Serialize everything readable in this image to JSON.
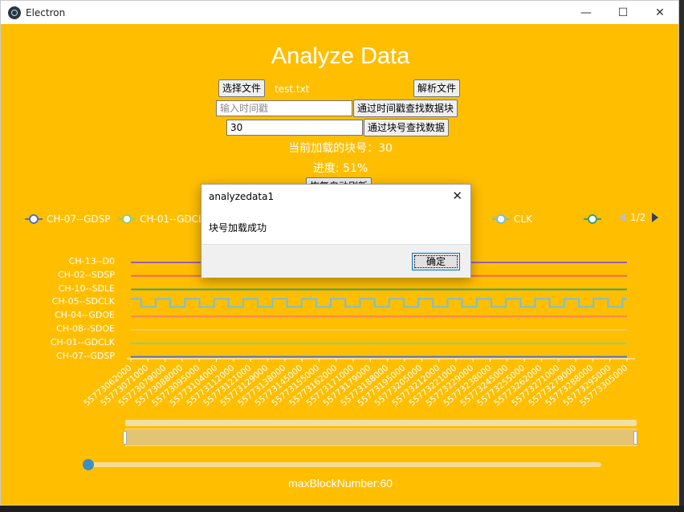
{
  "window": {
    "title": "Electron",
    "controls": {
      "minimize": "—",
      "maximize": "☐",
      "close": "✕"
    }
  },
  "page": {
    "heading": "Analyze Data",
    "choose_file_label": "选择文件",
    "file_name": "test.txt",
    "parse_file_label": "解析文件",
    "timestamp_placeholder": "输入时间戳",
    "find_by_timestamp_label": "通过时间戳查找数据块",
    "block_number_value": "30",
    "find_by_block_label": "通过块号查找数据",
    "current_block_text": "当前加载的块号：30",
    "progress_text": "进度: 51%",
    "auto_refresh_label": "恢复自动刷新",
    "max_block_text": "maxBlockNumber:60"
  },
  "colors": {
    "background": "#ffbe00",
    "accent": "#3b8fc4"
  },
  "chart_data": {
    "type": "line",
    "legend": {
      "items": [
        {
          "name": "CH-07--GDSP",
          "color": "#5470c6"
        },
        {
          "name": "CH-01--GDCLK",
          "color": "#91cc75"
        },
        {
          "name": "CH-05--SDCLK",
          "color": "#73c0de"
        },
        {
          "name": "CH-10--SDLE",
          "color": "#3ba272"
        },
        {
          "name": "CH-13--D0",
          "color": "#fc8452"
        }
      ],
      "page": "1/2"
    },
    "channels": [
      "CH-13--D0",
      "CH-02--SDSP",
      "CH-10--SDLE",
      "CH-05--SDCLK",
      "CH-04--GDOE",
      "CH-08--SDOE",
      "CH-01--GDCLK",
      "CH-07--GDSP"
    ],
    "x": [
      55773062000,
      55773071000,
      55773079000,
      55773088000,
      55773095000,
      55773104000,
      55773112000,
      55773121000,
      55773129000,
      55773138000,
      55773145000,
      55773155000,
      55773162000,
      55773171000,
      55773179000,
      55773188000,
      55773195000,
      55773205000,
      55773212000,
      55773221000,
      55773229000,
      55773238000,
      55773245000,
      55773255000,
      55773262000,
      55773271000,
      55773279000,
      55773288000,
      55773295000,
      55773305000
    ],
    "xlabels": [
      "55773062000",
      "55773071000",
      "55773079000",
      "55773088000",
      "55773095000",
      "55773104000",
      "55773112000",
      "55773121000",
      "55773129000",
      "55773138000",
      "55773145000",
      "55773155000",
      "55773162000",
      "55773171000",
      "55773179000",
      "55773188000",
      "55773195000",
      "55773205000",
      "55773212000",
      "55773221000",
      "55773229000",
      "55773238000",
      "55773245000",
      "55773255000",
      "55773262000",
      "55773271000",
      "55773279000",
      "55773288000",
      "55773295000",
      "55773305000"
    ],
    "series": [
      {
        "name": "CH-13--D0",
        "color": "#9a60b4",
        "pattern": "flat"
      },
      {
        "name": "CH-02--SDSP",
        "color": "#ee6666",
        "pattern": "flat"
      },
      {
        "name": "CH-10--SDLE",
        "color": "#3ba272",
        "pattern": "flat"
      },
      {
        "name": "CH-05--SDCLK",
        "color": "#73c0de",
        "pattern": "square",
        "periods": 17
      },
      {
        "name": "CH-04--GDOE",
        "color": "#fc8452",
        "pattern": "flat"
      },
      {
        "name": "CH-08--SDOE",
        "color": "#fac858",
        "pattern": "flat"
      },
      {
        "name": "CH-01--GDCLK",
        "color": "#91cc75",
        "pattern": "flat"
      },
      {
        "name": "CH-07--GDSP",
        "color": "#5470c6",
        "pattern": "flat"
      }
    ],
    "zoom": {
      "start": 0,
      "end": 100
    }
  },
  "dialog": {
    "title": "analyzedata1",
    "close_glyph": "✕",
    "message": "块号加载成功",
    "ok_label": "确定"
  }
}
